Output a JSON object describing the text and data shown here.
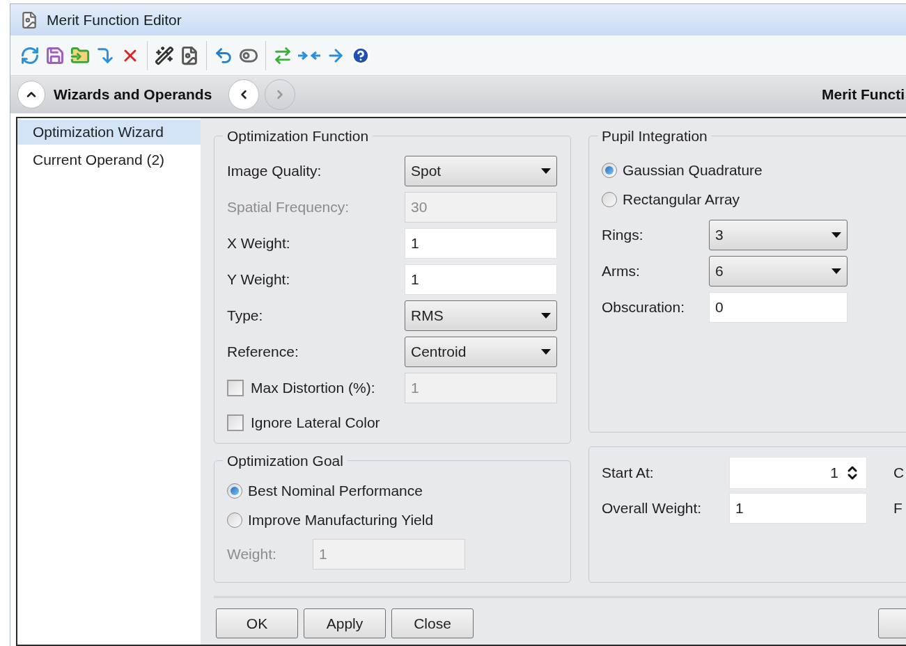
{
  "window": {
    "title": "Merit Function Editor"
  },
  "header": {
    "title": "Wizards and Operands",
    "back_disabled": false,
    "forward_disabled": true,
    "right_title": "Merit Functi"
  },
  "sidebar": {
    "items": [
      {
        "label": "Optimization Wizard",
        "selected": true
      },
      {
        "label": "Current Operand (2)",
        "selected": false
      }
    ]
  },
  "optimization_function": {
    "title": "Optimization Function",
    "rows": [
      {
        "kind": "dropdown",
        "label": "Image Quality:",
        "value": "Spot",
        "disabled": false
      },
      {
        "kind": "text",
        "label": "Spatial Frequency:",
        "value": "30",
        "disabled": true
      },
      {
        "kind": "text",
        "label": "X Weight:",
        "value": "1",
        "disabled": false
      },
      {
        "kind": "text",
        "label": "Y Weight:",
        "value": "1",
        "disabled": false
      },
      {
        "kind": "dropdown",
        "label": "Type:",
        "value": "RMS",
        "disabled": false
      },
      {
        "kind": "dropdown",
        "label": "Reference:",
        "value": "Centroid",
        "disabled": false
      },
      {
        "kind": "checkfield",
        "label": "Max Distortion (%):",
        "value": "1",
        "checked": false,
        "disabled": true
      },
      {
        "kind": "checkbox",
        "label": "Ignore Lateral Color",
        "checked": false
      }
    ]
  },
  "optimization_goal": {
    "title": "Optimization Goal",
    "options": [
      {
        "label": "Best Nominal Performance",
        "selected": true
      },
      {
        "label": "Improve Manufacturing Yield",
        "selected": false
      }
    ],
    "weight": {
      "label": "Weight:",
      "value": "1",
      "disabled": true
    }
  },
  "pupil_integration": {
    "title": "Pupil Integration",
    "options": [
      {
        "label": "Gaussian Quadrature",
        "selected": true
      },
      {
        "label": "Rectangular Array",
        "selected": false
      }
    ],
    "rows": [
      {
        "kind": "dropdown",
        "label": "Rings:",
        "value": "3",
        "disabled": false
      },
      {
        "kind": "dropdown",
        "label": "Arms:",
        "value": "6",
        "disabled": false
      },
      {
        "kind": "text",
        "label": "Obscuration:",
        "value": "0",
        "disabled": false
      }
    ]
  },
  "start": {
    "rows": [
      {
        "kind": "spinner",
        "label": "Start At:",
        "value": "1",
        "side_label": "C"
      },
      {
        "kind": "text",
        "label": "Overall Weight:",
        "value": "1",
        "side_label": "F"
      }
    ]
  },
  "buttons": [
    "OK",
    "Apply",
    "Close"
  ]
}
